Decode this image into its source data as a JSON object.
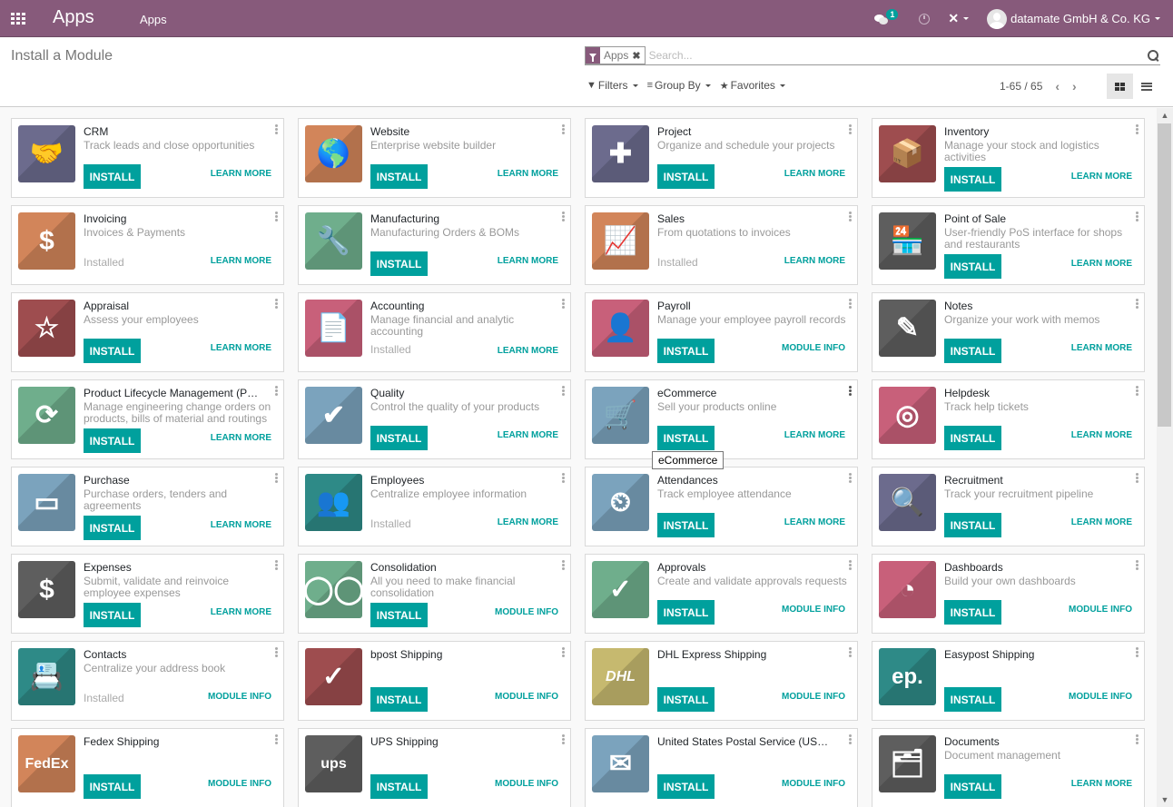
{
  "navbar": {
    "brand": "Apps",
    "menu_item": "Apps",
    "messages_badge": "1",
    "user_name": "datamate GmbH & Co. KG",
    "icons": [
      "apps-grid-icon",
      "chat-icon",
      "clock-icon",
      "tools-icon",
      "avatar"
    ]
  },
  "control": {
    "title": "Install a Module",
    "facet_label": "Apps",
    "search_placeholder": "Search...",
    "filters_label": "Filters",
    "groupby_label": "Group By",
    "favorites_label": "Favorites",
    "pager": "1-65 / 65",
    "prev": "‹",
    "next": "›"
  },
  "colors": {
    "brand": "#875a7b",
    "accent": "#00a09d"
  },
  "tooltip": "eCommerce",
  "apps": [
    {
      "name": "CRM",
      "desc": "Track leads and close opportunities",
      "status": "install",
      "install_label": "INSTALL",
      "link": "LEARN MORE",
      "color": "#6c6b8d",
      "glyph": "🤝"
    },
    {
      "name": "Website",
      "desc": "Enterprise website builder",
      "status": "install",
      "install_label": "INSTALL",
      "link": "LEARN MORE",
      "color": "#d2855a",
      "glyph": "🌎"
    },
    {
      "name": "Project",
      "desc": "Organize and schedule your projects",
      "status": "install",
      "install_label": "INSTALL",
      "link": "LEARN MORE",
      "color": "#6c6b8d",
      "glyph": "✚"
    },
    {
      "name": "Inventory",
      "desc": "Manage your stock and logistics activities",
      "status": "install",
      "install_label": "INSTALL",
      "link": "LEARN MORE",
      "color": "#9e4d4f",
      "glyph": "📦"
    },
    {
      "name": "Invoicing",
      "desc": "Invoices & Payments",
      "status": "installed",
      "installed_label": "Installed",
      "link": "LEARN MORE",
      "color": "#d2855a",
      "glyph": "$"
    },
    {
      "name": "Manufacturing",
      "desc": "Manufacturing Orders & BOMs",
      "status": "install",
      "install_label": "INSTALL",
      "link": "LEARN MORE",
      "color": "#6fae8c",
      "glyph": "🔧"
    },
    {
      "name": "Sales",
      "desc": "From quotations to invoices",
      "status": "installed",
      "installed_label": "Installed",
      "link": "LEARN MORE",
      "color": "#d2855a",
      "glyph": "📈"
    },
    {
      "name": "Point of Sale",
      "desc": "User-friendly PoS interface for shops and restaurants",
      "status": "install",
      "install_label": "INSTALL",
      "link": "LEARN MORE",
      "color": "#5e5e5e",
      "glyph": "🏪"
    },
    {
      "name": "Appraisal",
      "desc": "Assess your employees",
      "status": "install",
      "install_label": "INSTALL",
      "link": "LEARN MORE",
      "color": "#9e4d4f",
      "glyph": "☆"
    },
    {
      "name": "Accounting",
      "desc": "Manage financial and analytic accounting",
      "status": "installed",
      "installed_label": "Installed",
      "link": "LEARN MORE",
      "color": "#c8607a",
      "glyph": "📄"
    },
    {
      "name": "Payroll",
      "desc": "Manage your employee payroll records",
      "status": "install",
      "install_label": "INSTALL",
      "link": "MODULE INFO",
      "color": "#c8607a",
      "glyph": "👤"
    },
    {
      "name": "Notes",
      "desc": "Organize your work with memos",
      "status": "install",
      "install_label": "INSTALL",
      "link": "LEARN MORE",
      "color": "#5e5e5e",
      "glyph": "✎"
    },
    {
      "name": "Product Lifecycle Management (PLM)",
      "desc": "Manage engineering change orders on products, bills of material and routings",
      "status": "install",
      "install_label": "INSTALL",
      "link": "LEARN MORE",
      "color": "#6fae8c",
      "glyph": "⟳"
    },
    {
      "name": "Quality",
      "desc": "Control the quality of your products",
      "status": "install",
      "install_label": "INSTALL",
      "link": "LEARN MORE",
      "color": "#7ba3bd",
      "glyph": "✔"
    },
    {
      "name": "eCommerce",
      "desc": "Sell your products online",
      "status": "install",
      "install_label": "INSTALL",
      "link": "LEARN MORE",
      "color": "#7ba3bd",
      "glyph": "🛒"
    },
    {
      "name": "Helpdesk",
      "desc": "Track help tickets",
      "status": "install",
      "install_label": "INSTALL",
      "link": "LEARN MORE",
      "color": "#c8607a",
      "glyph": "◎"
    },
    {
      "name": "Purchase",
      "desc": "Purchase orders, tenders and agreements",
      "status": "install",
      "install_label": "INSTALL",
      "link": "LEARN MORE",
      "color": "#7ba3bd",
      "glyph": "▭"
    },
    {
      "name": "Employees",
      "desc": "Centralize employee information",
      "status": "installed",
      "installed_label": "Installed",
      "link": "LEARN MORE",
      "color": "#2e8a87",
      "glyph": "👥"
    },
    {
      "name": "Attendances",
      "desc": "Track employee attendance",
      "status": "install",
      "install_label": "INSTALL",
      "link": "LEARN MORE",
      "color": "#7ba3bd",
      "glyph": "⏲"
    },
    {
      "name": "Recruitment",
      "desc": "Track your recruitment pipeline",
      "status": "install",
      "install_label": "INSTALL",
      "link": "LEARN MORE",
      "color": "#6c6b8d",
      "glyph": "🔍"
    },
    {
      "name": "Expenses",
      "desc": "Submit, validate and reinvoice employee expenses",
      "status": "install",
      "install_label": "INSTALL",
      "link": "LEARN MORE",
      "color": "#5e5e5e",
      "glyph": "$"
    },
    {
      "name": "Consolidation",
      "desc": "All you need to make financial consolidation",
      "status": "install",
      "install_label": "INSTALL",
      "link": "MODULE INFO",
      "color": "#6fae8c",
      "glyph": "◯◯"
    },
    {
      "name": "Approvals",
      "desc": "Create and validate approvals requests",
      "status": "install",
      "install_label": "INSTALL",
      "link": "MODULE INFO",
      "color": "#6fae8c",
      "glyph": "✓"
    },
    {
      "name": "Dashboards",
      "desc": "Build your own dashboards",
      "status": "install",
      "install_label": "INSTALL",
      "link": "MODULE INFO",
      "color": "#c8607a",
      "glyph": "◔"
    },
    {
      "name": "Contacts",
      "desc": "Centralize your address book",
      "status": "installed",
      "installed_label": "Installed",
      "link": "MODULE INFO",
      "color": "#2e8a87",
      "glyph": "📇"
    },
    {
      "name": "bpost Shipping",
      "desc": "",
      "status": "install",
      "install_label": "INSTALL",
      "link": "MODULE INFO",
      "color": "#9e4d4f",
      "glyph": "✓"
    },
    {
      "name": "DHL Express Shipping",
      "desc": "",
      "status": "install",
      "install_label": "INSTALL",
      "link": "MODULE INFO",
      "color": "#c6b96f",
      "glyph": "DHL"
    },
    {
      "name": "Easypost Shipping",
      "desc": "",
      "status": "install",
      "install_label": "INSTALL",
      "link": "MODULE INFO",
      "color": "#2e8a87",
      "glyph": "ep."
    },
    {
      "name": "Fedex Shipping",
      "desc": "",
      "status": "install",
      "install_label": "INSTALL",
      "link": "MODULE INFO",
      "color": "#d2855a",
      "glyph": "FedEx"
    },
    {
      "name": "UPS Shipping",
      "desc": "",
      "status": "install",
      "install_label": "INSTALL",
      "link": "MODULE INFO",
      "color": "#5e5e5e",
      "glyph": "ups"
    },
    {
      "name": "United States Postal Service (USPS)",
      "desc": "",
      "status": "install",
      "install_label": "INSTALL",
      "link": "MODULE INFO",
      "color": "#7ba3bd",
      "glyph": "✉"
    },
    {
      "name": "Documents",
      "desc": "Document management",
      "status": "install",
      "install_label": "INSTALL",
      "link": "LEARN MORE",
      "color": "#5e5e5e",
      "glyph": "🗂"
    }
  ]
}
